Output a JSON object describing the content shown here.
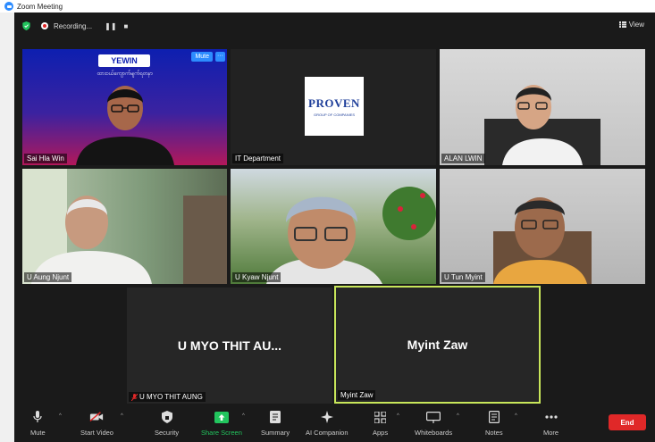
{
  "window": {
    "title": "Zoom Meeting"
  },
  "topbar": {
    "recording_label": "Recording...",
    "pause_glyph": "❚❚",
    "stop_glyph": "■",
    "view_label": "View"
  },
  "tiles": [
    {
      "name": "Sai Hla Win",
      "mute_label": "Mute",
      "more_label": "···",
      "banner_logo": "YEWIN",
      "banner_text": "ထားဝယ်ကျောက်မျက်ရတနာ"
    },
    {
      "name": "IT Department",
      "logo_main": "PROVEN",
      "logo_sub": "GROUP OF COMPANIES"
    },
    {
      "name": "ALAN LWIN"
    },
    {
      "name": "U Aung Njunt"
    },
    {
      "name": "U Kyaw Njunt"
    },
    {
      "name": "U Tun Myint"
    },
    {
      "name": "U MYO THIT AUNG",
      "display_name": "U MYO THIT AU..."
    },
    {
      "name": "Myint Zaw",
      "display_name": "Myint Zaw"
    }
  ],
  "toolbar": {
    "items": [
      {
        "label": "Mute",
        "icon": "microphone-icon"
      },
      {
        "label": "Start Video",
        "icon": "video-off-icon"
      },
      {
        "label": "Security",
        "icon": "shield-icon"
      },
      {
        "label": "Share Screen",
        "icon": "share-screen-icon"
      },
      {
        "label": "Summary",
        "icon": "summary-icon"
      },
      {
        "label": "AI Companion",
        "icon": "ai-companion-icon"
      },
      {
        "label": "Apps",
        "icon": "apps-icon"
      },
      {
        "label": "Whiteboards",
        "icon": "whiteboard-icon"
      },
      {
        "label": "Notes",
        "icon": "notes-icon"
      },
      {
        "label": "More",
        "icon": "more-icon"
      }
    ],
    "end_label": "End"
  },
  "colors": {
    "accent": "#2D8CFF",
    "share_green": "#22c55e",
    "end_red": "#e02828",
    "active_speaker": "#c8e65a"
  }
}
